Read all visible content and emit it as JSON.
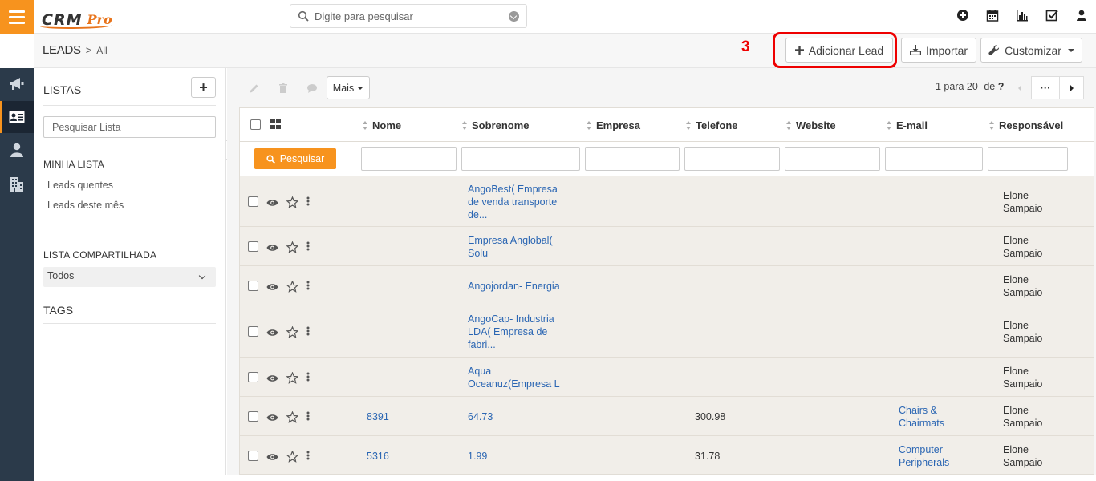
{
  "topbar": {
    "logo_text": "CRM",
    "logo_suffix": "Pro",
    "search_placeholder": "Digite para pesquisar",
    "icons": [
      "plus-circle-icon",
      "calendar-icon",
      "bar-chart-icon",
      "checkbox-icon",
      "user-icon"
    ]
  },
  "header": {
    "breadcrumb_main": "LEADS",
    "breadcrumb_sep": ">",
    "breadcrumb_sub": "All",
    "step_number": "3",
    "add_lead_label": "Adicionar Lead",
    "import_label": "Importar",
    "customize_label": "Customizar"
  },
  "rail": {
    "items": [
      "megaphone-icon",
      "contact-card-icon",
      "person-icon",
      "building-icon"
    ],
    "active_index": 1
  },
  "sidebar": {
    "lists_title": "LISTAS",
    "add_label": "+",
    "search_placeholder": "Pesquisar Lista",
    "my_list_title": "MINHA LISTA",
    "my_list_items": [
      "Leads quentes",
      "Leads deste mês"
    ],
    "shared_title": "LISTA COMPARTILHADA",
    "shared_selected": "Todos",
    "tags_title": "TAGS"
  },
  "toolbar": {
    "more_label": "Mais",
    "pager_text": "1 para 20",
    "pager_of": "de",
    "pager_total": "?",
    "more_pages_label": "···"
  },
  "grid": {
    "columns": [
      "Nome",
      "Sobrenome",
      "Empresa",
      "Telefone",
      "Website",
      "E-mail",
      "Responsável"
    ],
    "search_button": "Pesquisar",
    "rows": [
      {
        "nome": "",
        "sobrenome": [
          "AngoBest( Empresa",
          "de venda transporte",
          "de..."
        ],
        "telefone": "",
        "email": [],
        "responsavel": [
          "Elone",
          "Sampaio"
        ]
      },
      {
        "nome": "",
        "sobrenome": [
          "Empresa Anglobal(",
          "Solu"
        ],
        "telefone": "",
        "email": [],
        "responsavel": [
          "Elone",
          "Sampaio"
        ]
      },
      {
        "nome": "",
        "sobrenome": [
          "Angojordan- Energia"
        ],
        "telefone": "",
        "email": [],
        "responsavel": [
          "Elone",
          "Sampaio"
        ]
      },
      {
        "nome": "",
        "sobrenome": [
          "AngoCap- Industria",
          "LDA( Empresa de",
          "fabri..."
        ],
        "telefone": "",
        "email": [],
        "responsavel": [
          "Elone",
          "Sampaio"
        ]
      },
      {
        "nome": "",
        "sobrenome": [
          "Aqua",
          "Oceanuz(Empresa L"
        ],
        "telefone": "",
        "email": [],
        "responsavel": [
          "Elone",
          "Sampaio"
        ]
      },
      {
        "nome": "8391",
        "sobrenome": [
          "64.73"
        ],
        "telefone": "300.98",
        "email": [
          "Chairs &",
          "Chairmats"
        ],
        "responsavel": [
          "Elone",
          "Sampaio"
        ]
      },
      {
        "nome": "5316",
        "sobrenome": [
          "1.99"
        ],
        "telefone": "31.78",
        "email": [
          "Computer",
          "Peripherals"
        ],
        "responsavel": [
          "Elone",
          "Sampaio"
        ]
      }
    ]
  },
  "colors": {
    "accent": "#f7931e",
    "rail_bg": "#2b3a4a",
    "link": "#2b66b3",
    "highlight": "#ee0000"
  }
}
